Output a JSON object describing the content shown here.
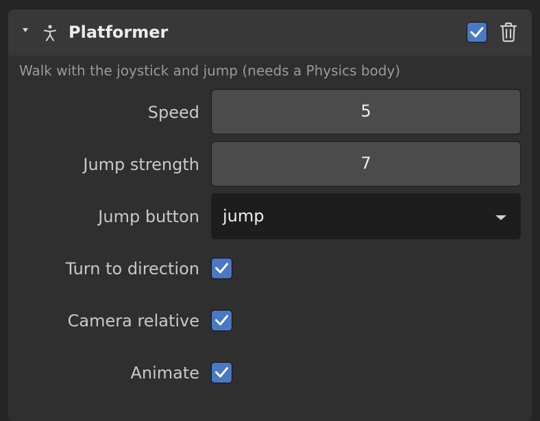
{
  "component": {
    "title": "Platformer",
    "icon": "person-icon",
    "enabled": true,
    "description": "Walk with the joystick and jump (needs a Physics body)"
  },
  "fields": {
    "speed": {
      "label": "Speed",
      "value": "5"
    },
    "jump_strength": {
      "label": "Jump strength",
      "value": "7"
    },
    "jump_button": {
      "label": "Jump button",
      "value": "jump"
    },
    "turn_to_direction": {
      "label": "Turn to direction",
      "checked": true
    },
    "camera_relative": {
      "label": "Camera relative",
      "checked": true
    },
    "animate": {
      "label": "Animate",
      "checked": true
    }
  },
  "colors": {
    "accent": "#4a78c4",
    "panel_bg": "#2f2f2f",
    "header_bg": "#383838",
    "input_bg": "#4b4b4b",
    "select_bg": "#1d1d1d"
  },
  "icons": [
    "chevron-down-icon",
    "person-icon",
    "checkmark-icon",
    "trash-icon",
    "dropdown-arrow-icon"
  ]
}
